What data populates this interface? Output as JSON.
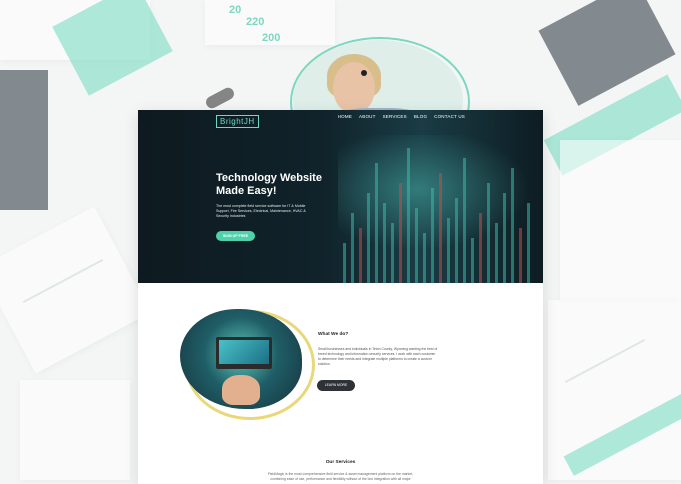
{
  "site": {
    "logo": "BrightJH",
    "nav": [
      "HOME",
      "ABOUT",
      "SERVICES",
      "BLOG",
      "CONTACT US"
    ]
  },
  "hero": {
    "title": "Technology Website\nMade Easy!",
    "text": "The most complete field service software for IT & Mobile Support, Fire Services, Electrical, Maintenance, HVAC & Security industries",
    "button": "SIGN UP FREE"
  },
  "about": {
    "title": "What We do?",
    "text": "Small businesses and individuals in Teton County, Wyoming wanting the best of breed technology and information security services. I work with each customer to determine their needs and integrate multiple platforms to create a custom solution.",
    "button": "LEARN MORE"
  },
  "services": {
    "title": "Our Services",
    "text": "FieldMagic is the most comprehensive field service & asset management platform on the market, combining ease of use, performance and flexibility without of the box integration with all major"
  },
  "background": {
    "numbers": [
      "20",
      "220",
      "200"
    ]
  },
  "colors": {
    "accent": "#4fd1ac",
    "dark": "#2e3236",
    "hero_bg": "#10222a"
  }
}
